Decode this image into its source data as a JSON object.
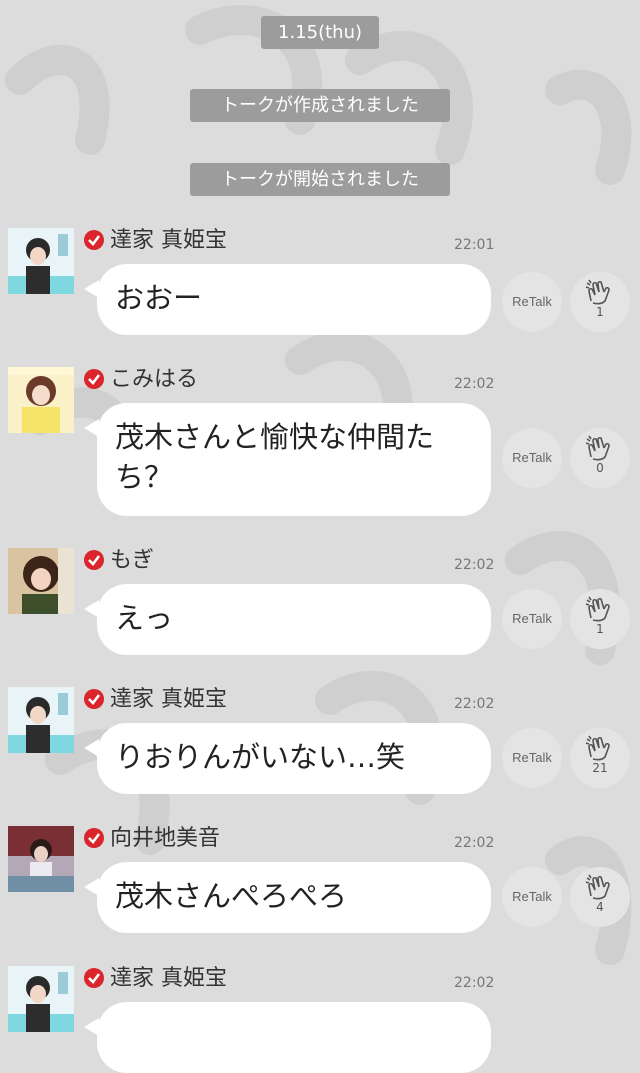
{
  "date_label": "1.15(thu)",
  "system_messages": [
    "トークが作成されました",
    "トークが開始されました"
  ],
  "retalk_label": "ReTalk",
  "colors": {
    "background": "#dcdcdc",
    "system_pill": "#9c9c9c",
    "bubble": "#ffffff",
    "check_badge": "#d9252b"
  },
  "messages": [
    {
      "name": "達家 真姫宝",
      "time": "22:01",
      "text": "おおー",
      "claps": "1",
      "avatar": "avatar-icon"
    },
    {
      "name": "こみはる",
      "time": "22:02",
      "text": "茂木さんと愉快な仲間たち？",
      "claps": "0",
      "avatar": "avatar-icon"
    },
    {
      "name": "もぎ",
      "time": "22:02",
      "text": "えっ",
      "claps": "1",
      "avatar": "avatar-icon"
    },
    {
      "name": "達家 真姫宝",
      "time": "22:02",
      "text": "りおりんがいない…笑",
      "claps": "21",
      "avatar": "avatar-icon"
    },
    {
      "name": "向井地美音",
      "time": "22:02",
      "text": "茂木さんぺろぺろ",
      "claps": "4",
      "avatar": "avatar-icon"
    },
    {
      "name": "達家 真姫宝",
      "time": "22:02",
      "text": "",
      "claps": "",
      "avatar": "avatar-icon"
    }
  ]
}
